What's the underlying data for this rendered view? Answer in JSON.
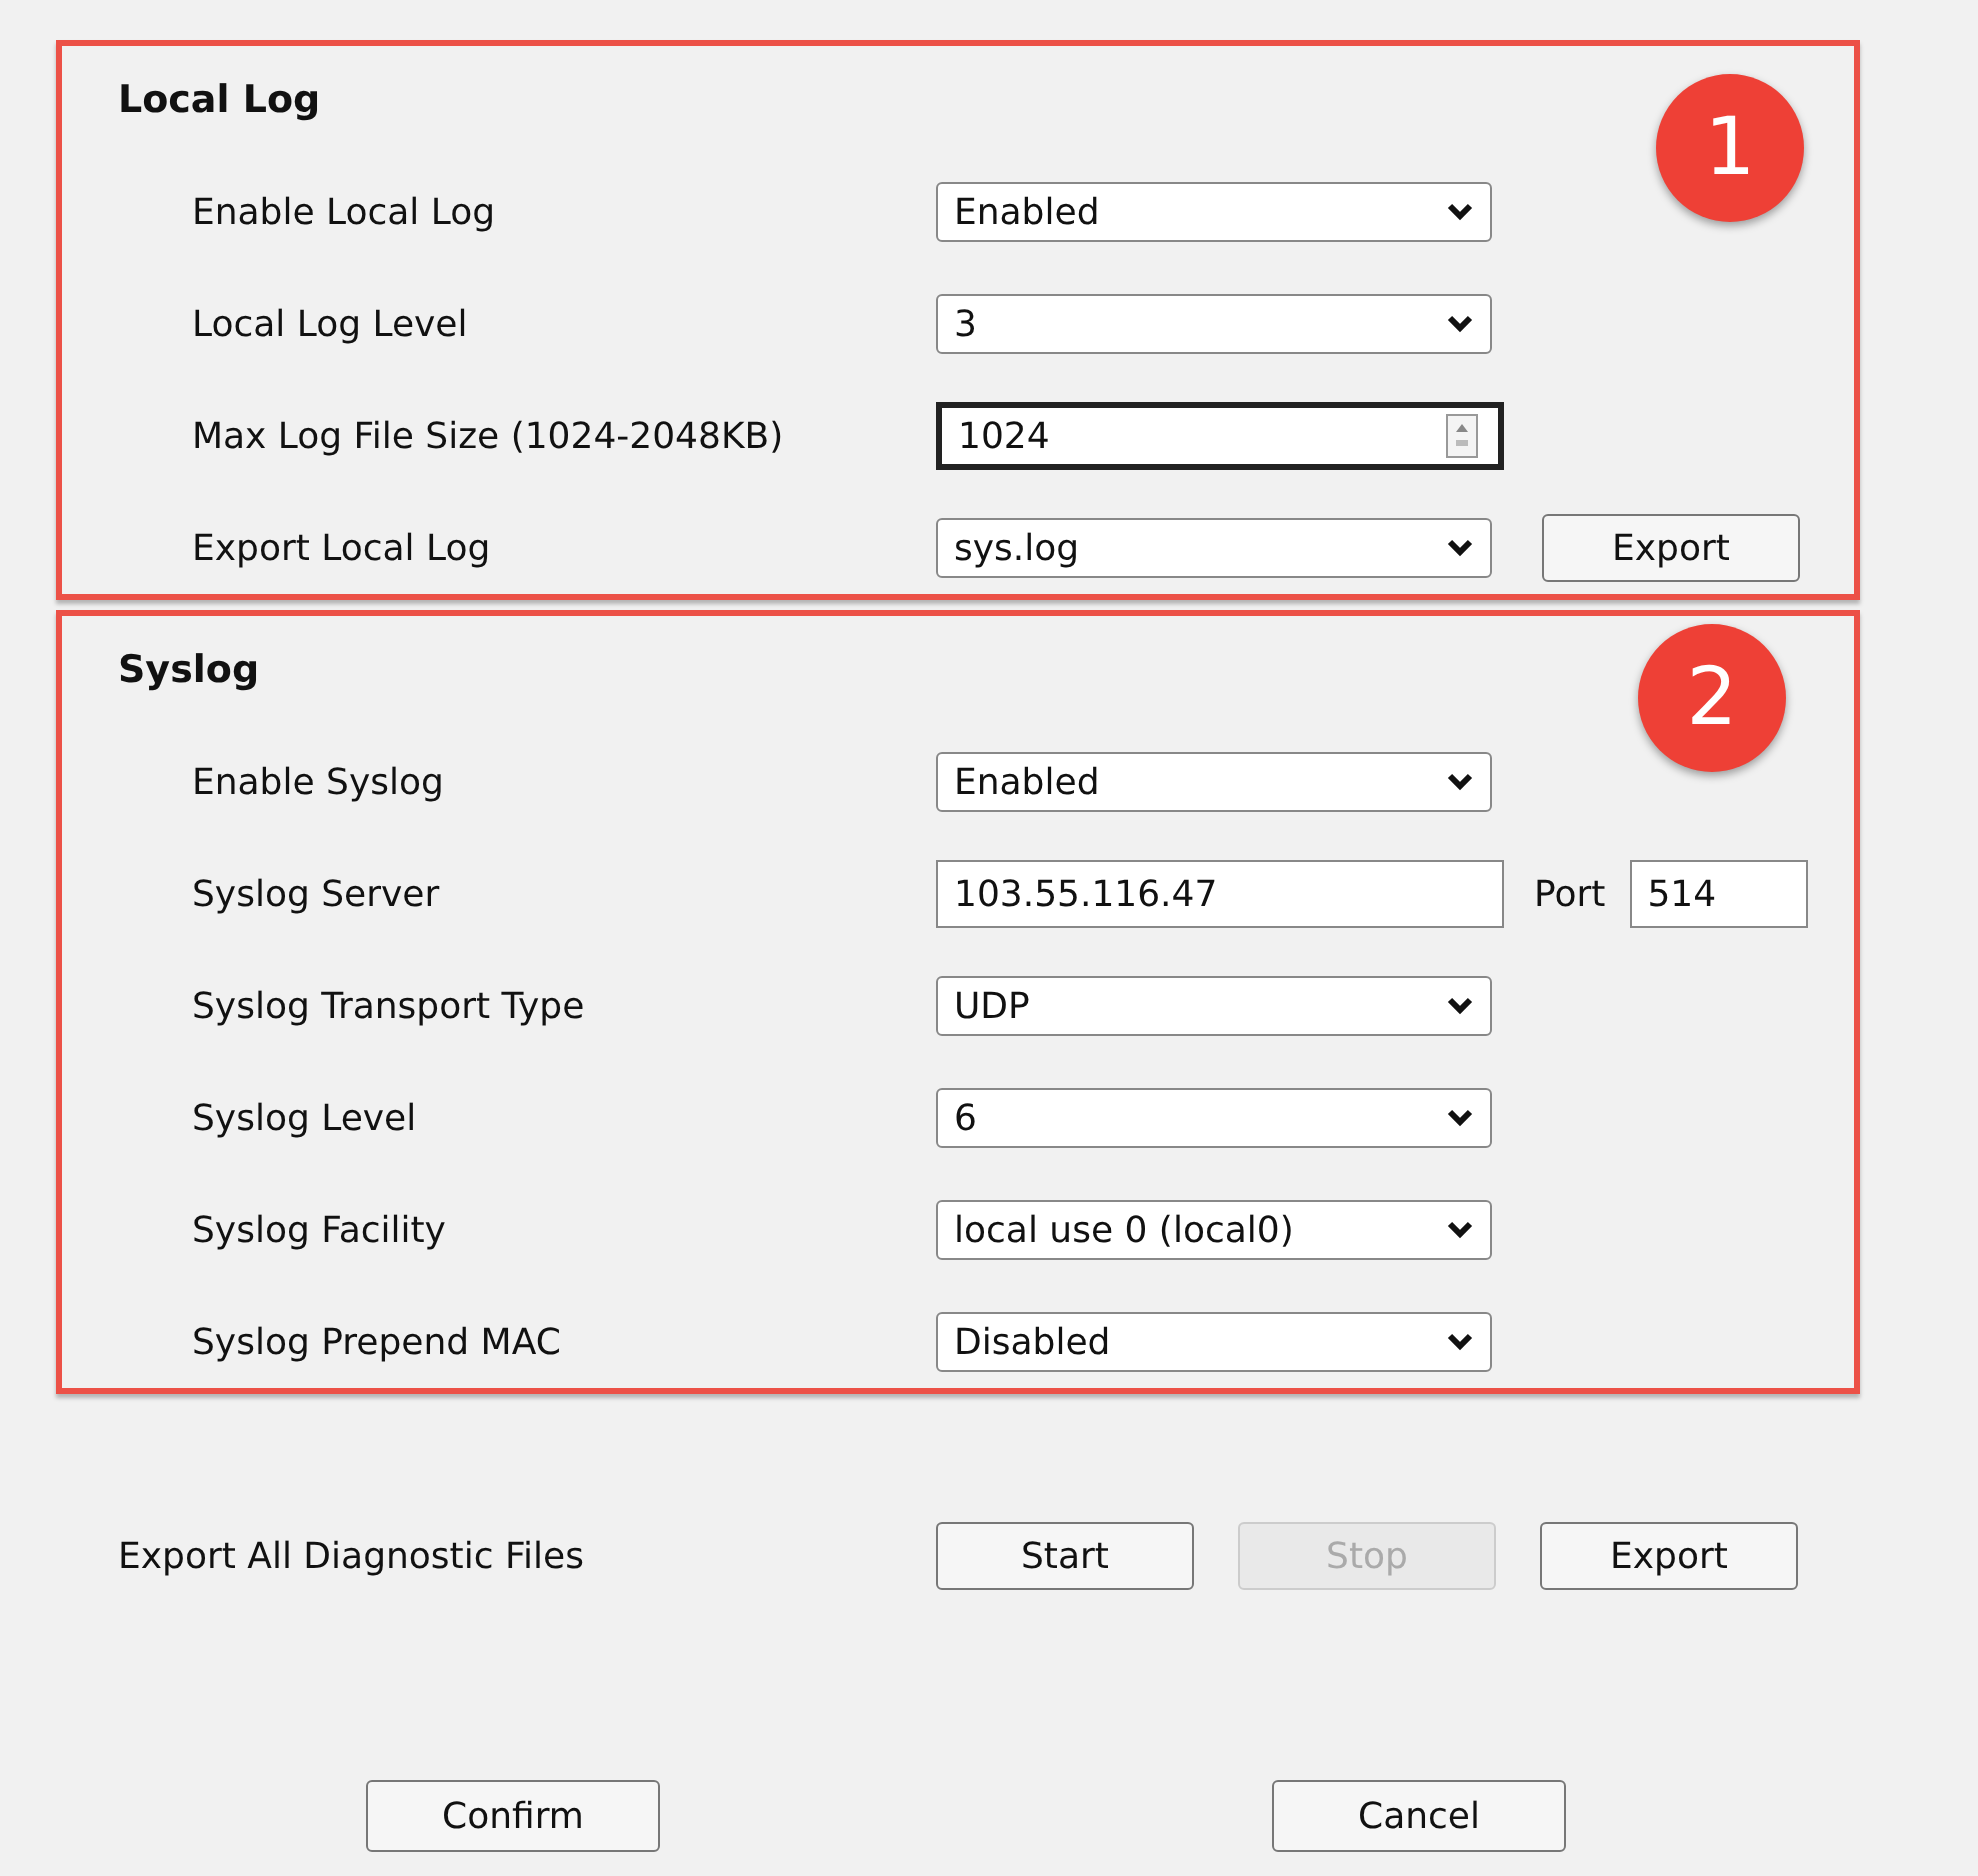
{
  "sections": [
    {
      "title": "Local Log",
      "badge": "1",
      "rows": [
        {
          "kind": "select",
          "label": "Enable Local Log",
          "value": "Enabled"
        },
        {
          "kind": "select",
          "label": "Local Log Level",
          "value": "3"
        },
        {
          "kind": "number",
          "label": "Max Log File Size (1024-2048KB)",
          "value": "1024",
          "focused": true
        },
        {
          "kind": "select",
          "label": "Export Local Log",
          "value": "sys.log",
          "button": "Export"
        }
      ]
    },
    {
      "title": "Syslog",
      "badge": "2",
      "rows": [
        {
          "kind": "select",
          "label": "Enable Syslog",
          "value": "Enabled"
        },
        {
          "kind": "text",
          "label": "Syslog Server",
          "value": "103.55.116.47",
          "port_label": "Port",
          "port_value": "514"
        },
        {
          "kind": "select",
          "label": "Syslog Transport Type",
          "value": "UDP"
        },
        {
          "kind": "select",
          "label": "Syslog Level",
          "value": "6"
        },
        {
          "kind": "select",
          "label": "Syslog Facility",
          "value": "local use 0 (local0)"
        },
        {
          "kind": "select",
          "label": "Syslog Prepend MAC",
          "value": "Disabled"
        }
      ]
    }
  ],
  "diagnostics": {
    "label": "Export All Diagnostic Files",
    "buttons": [
      {
        "label": "Start",
        "disabled": false
      },
      {
        "label": "Stop",
        "disabled": true
      },
      {
        "label": "Export",
        "disabled": false
      }
    ]
  },
  "footer": [
    "Confirm",
    "Cancel"
  ]
}
